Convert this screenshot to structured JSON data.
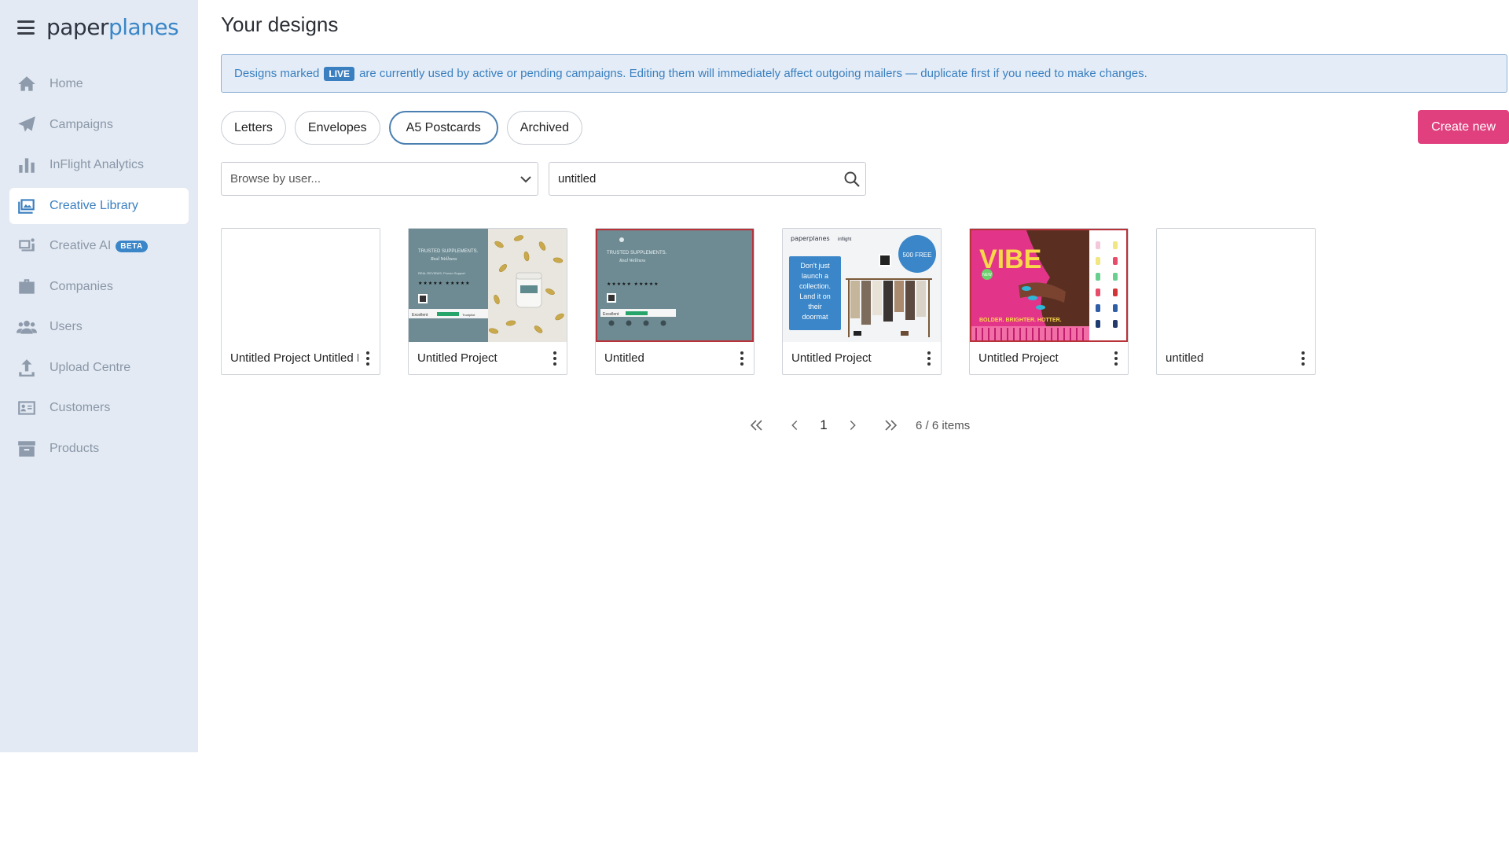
{
  "brand": {
    "logo_part1": "paper",
    "logo_part2": "planes"
  },
  "sidebar": {
    "items": [
      {
        "label": "Home",
        "icon": "home-icon"
      },
      {
        "label": "Campaigns",
        "icon": "paper-plane-icon"
      },
      {
        "label": "InFlight Analytics",
        "icon": "bar-chart-icon"
      },
      {
        "label": "Creative Library",
        "icon": "image-library-icon",
        "active": true
      },
      {
        "label": "Creative AI",
        "icon": "creative-ai-icon",
        "badge": "BETA"
      },
      {
        "label": "Companies",
        "icon": "briefcase-icon"
      },
      {
        "label": "Users",
        "icon": "users-icon"
      },
      {
        "label": "Upload Centre",
        "icon": "upload-icon"
      },
      {
        "label": "Customers",
        "icon": "id-card-icon"
      },
      {
        "label": "Products",
        "icon": "archive-box-icon"
      }
    ]
  },
  "main": {
    "title": "Your designs",
    "notice": {
      "prefix": "Designs marked",
      "badge": "LIVE",
      "suffix": "are currently used by active or pending campaigns. Editing them will immediately affect outgoing mailers — duplicate first if you need to make changes."
    },
    "tabs": [
      {
        "label": "Letters"
      },
      {
        "label": "Envelopes"
      },
      {
        "label": "A5 Postcards",
        "active": true
      },
      {
        "label": "Archived"
      }
    ],
    "create_label": "Create new",
    "user_select": {
      "placeholder": "Browse by user..."
    },
    "search": {
      "value": "untitled"
    },
    "designs": [
      {
        "title": "Untitled Project Untitled Project",
        "thumb": "blank"
      },
      {
        "title": "Untitled Project",
        "thumb": "supplements-capsules"
      },
      {
        "title": "Untitled",
        "thumb": "supplements-teal",
        "selected": true
      },
      {
        "title": "Untitled Project",
        "thumb": "paperplanes-clothing-rack"
      },
      {
        "title": "Untitled Project",
        "thumb": "vibe-nail-polish"
      },
      {
        "title": "untitled",
        "thumb": "blank"
      }
    ],
    "thumb_text": {
      "supp_line1": "TRUSTED SUPPLEMENTS.",
      "supp_line2": "Real Wellness",
      "supp_line3": "REAL REVIEWS. Proven Support",
      "supp_excellent": "Excellent",
      "supp_trustpilot": "Trustpilot",
      "pp_logo": "paperplanes",
      "pp_inflight": "inflight",
      "pp_panel_1": "Don't just",
      "pp_panel_2": "launch a",
      "pp_panel_3": "collection.",
      "pp_panel_4": "Land it on",
      "pp_panel_5": "their",
      "pp_panel_6": "doormat",
      "pp_badge_1": "500 FREE",
      "vibe_title": "VIBE",
      "vibe_new": "NEW",
      "vibe_tagline": "BOLDER. BRIGHTER. HOTTER."
    },
    "pagination": {
      "page": "1",
      "info": "6 / 6 items"
    }
  },
  "colors": {
    "accent": "#3a7fc0",
    "create": "#e0407e",
    "sidebar_bg": "#e3eaf3",
    "selected_border": "#b8323a"
  }
}
